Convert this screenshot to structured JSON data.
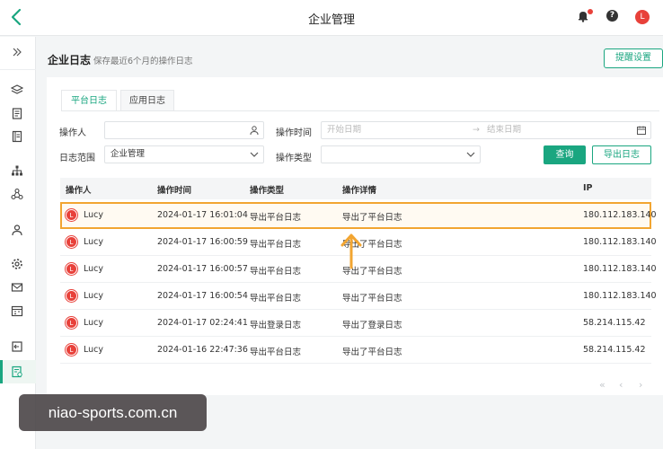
{
  "topbar": {
    "title": "企业管理",
    "avatar_letter": "L",
    "help_glyph": "?",
    "icons": [
      "back-chevron-icon",
      "bell-icon",
      "help-icon"
    ]
  },
  "sidebar": {
    "icons": [
      "expand-icon",
      "layers-icon",
      "clipboard-icon",
      "book-icon",
      "org-tree-icon",
      "network-icon",
      "user-icon",
      "settings-icon",
      "mail-icon",
      "calendar-icon",
      "exit-icon",
      "log-icon"
    ],
    "active": "log-icon"
  },
  "header": {
    "title": "企业日志",
    "subtitle": "保存最近6个月的操作日志",
    "remind_button": "提醒设置"
  },
  "tabs": [
    {
      "label": "平台日志",
      "active": true
    },
    {
      "label": "应用日志",
      "active": false
    }
  ],
  "filters": {
    "operator_label": "操作人",
    "operator_value": "",
    "time_label": "操作时间",
    "start_placeholder": "开始日期",
    "range_sep": "→",
    "end_placeholder": "结束日期",
    "scope_label": "日志范围",
    "scope_value": "企业管理",
    "type_label": "操作类型",
    "type_value": "",
    "query_button": "查询",
    "export_button": "导出日志"
  },
  "table": {
    "columns": [
      "操作人",
      "操作时间",
      "操作类型",
      "操作详情",
      "IP"
    ],
    "rows": [
      {
        "avatar": "L",
        "user": "Lucy",
        "time": "2024-01-17 16:01:04",
        "type": "导出平台日志",
        "detail": "导出了平台日志",
        "ip": "180.112.183.140"
      },
      {
        "avatar": "L",
        "user": "Lucy",
        "time": "2024-01-17 16:00:59",
        "type": "导出平台日志",
        "detail": "导出了平台日志",
        "ip": "180.112.183.140"
      },
      {
        "avatar": "L",
        "user": "Lucy",
        "time": "2024-01-17 16:00:57",
        "type": "导出平台日志",
        "detail": "导出了平台日志",
        "ip": "180.112.183.140"
      },
      {
        "avatar": "L",
        "user": "Lucy",
        "time": "2024-01-17 16:00:54",
        "type": "导出平台日志",
        "detail": "导出了平台日志",
        "ip": "180.112.183.140"
      },
      {
        "avatar": "L",
        "user": "Lucy",
        "time": "2024-01-17 02:24:41",
        "type": "导出登录日志",
        "detail": "导出了登录日志",
        "ip": "58.214.115.42"
      },
      {
        "avatar": "L",
        "user": "Lucy",
        "time": "2024-01-16 22:47:36",
        "type": "导出平台日志",
        "detail": "导出了平台日志",
        "ip": "58.214.115.42"
      }
    ]
  },
  "pager": {
    "first": "«",
    "prev": "‹",
    "next": "›"
  },
  "watermark": "niao-sports.com.cn",
  "colors": {
    "accent": "#1aa680",
    "highlight": "#f2a531",
    "avatar": "#e8413a"
  }
}
